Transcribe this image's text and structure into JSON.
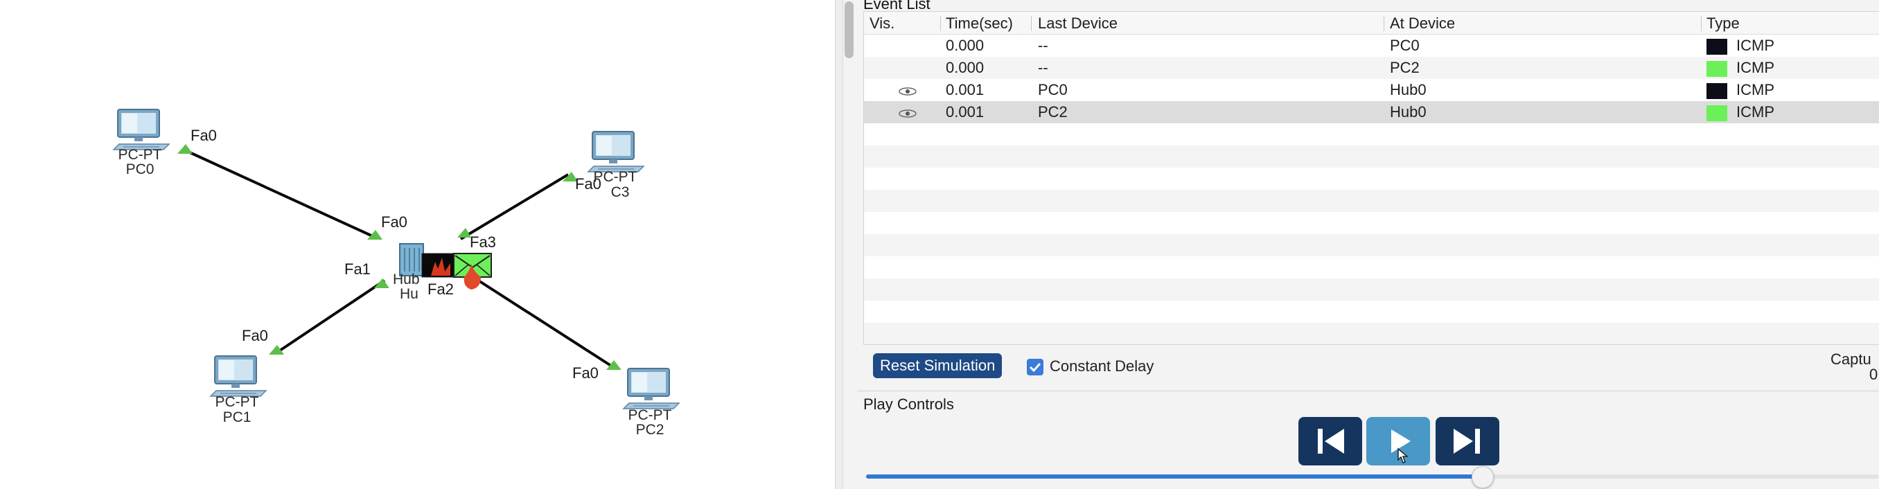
{
  "topology": {
    "devices": [
      {
        "id": "pc0",
        "model": "PC-PT",
        "name": "PC0"
      },
      {
        "id": "pc1",
        "model": "PC-PT",
        "name": "PC1"
      },
      {
        "id": "pc2",
        "model": "PC-PT",
        "name": "PC2"
      },
      {
        "id": "pc3",
        "model": "PC-PT",
        "name": "C3"
      },
      {
        "id": "hub",
        "model": "Hub",
        "name": "Hu"
      }
    ],
    "ports": {
      "pc0_fa0": "Fa0",
      "hub_fa0": "Fa0",
      "hub_fa1": "Fa1",
      "hub_fa2": "Fa2",
      "hub_fa3": "Fa3",
      "pc1_fa0": "Fa0",
      "pc2_fa0": "Fa0",
      "pc3_fa0": "Fa0"
    }
  },
  "event_list": {
    "title": "Event List",
    "columns": [
      "Vis.",
      "Time(sec)",
      "Last Device",
      "At Device",
      "Type"
    ],
    "rows": [
      {
        "vis": "",
        "time": "0.000",
        "last": "--",
        "at": "PC0",
        "type": "ICMP",
        "color": "#0d0d1a",
        "selected": false
      },
      {
        "vis": "",
        "time": "0.000",
        "last": "--",
        "at": "PC2",
        "type": "ICMP",
        "color": "#6cf05a",
        "selected": false
      },
      {
        "vis": "eye-icon",
        "time": "0.001",
        "last": "PC0",
        "at": "Hub0",
        "type": "ICMP",
        "color": "#0d0d1a",
        "selected": false
      },
      {
        "vis": "eye-icon",
        "time": "0.001",
        "last": "PC2",
        "at": "Hub0",
        "type": "ICMP",
        "color": "#6cf05a",
        "selected": true
      }
    ]
  },
  "controls": {
    "reset_label": "Reset Simulation",
    "constant_delay_label": "Constant Delay",
    "constant_delay_checked": true,
    "capture_label": "Captu",
    "capture_value": "0"
  },
  "play": {
    "title": "Play Controls",
    "back_icon": "skip-back-icon",
    "play_icon": "play-icon",
    "forward_icon": "skip-forward-icon",
    "speed_fraction": 0.608
  },
  "colors": {
    "accent": "#2f78d6",
    "reset": "#1e4a85",
    "port_green": "#5cbf4a",
    "collision_red": "#e04a2a"
  }
}
